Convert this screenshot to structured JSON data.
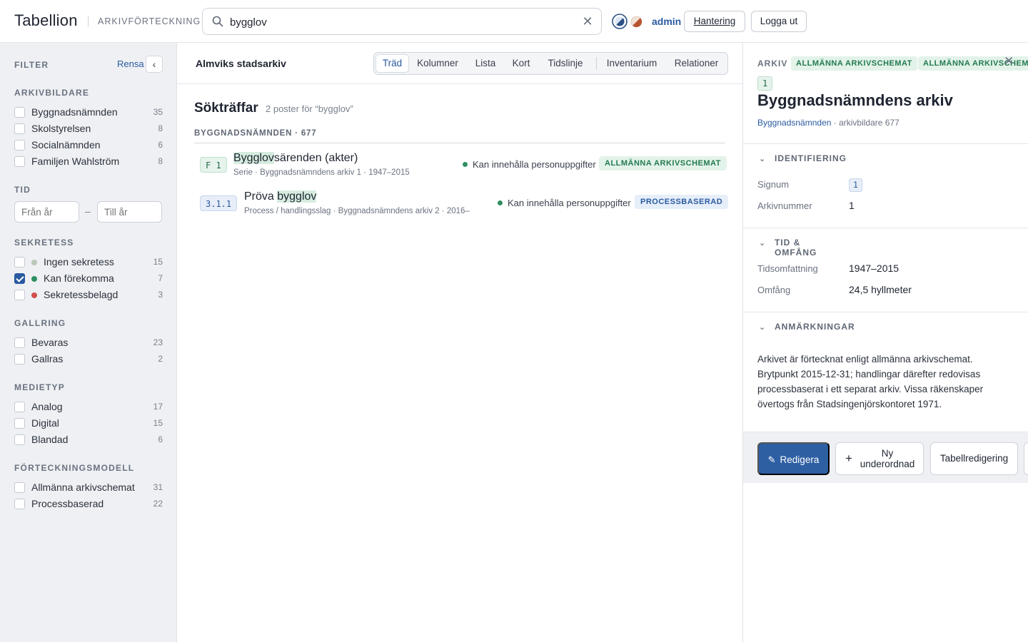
{
  "header": {
    "brand": "Tabellion",
    "subtitle": "ARKIVFÖRTECKNING",
    "search_value": "bygglov",
    "user": "admin",
    "manage_label": "Hantering",
    "logout_label": "Logga ut"
  },
  "sidebar": {
    "title": "FILTER",
    "clear": "Rensa",
    "groups": {
      "creators": {
        "title": "ARKIVBILDARE",
        "items": [
          {
            "label": "Byggnadsnämnden",
            "count": "35",
            "checked": false
          },
          {
            "label": "Skolstyrelsen",
            "count": "8",
            "checked": false
          },
          {
            "label": "Socialnämnden",
            "count": "6",
            "checked": false
          },
          {
            "label": "Familjen Wahlström",
            "count": "8",
            "checked": false
          }
        ]
      },
      "time": {
        "title": "TID",
        "from_placeholder": "Från år",
        "to_placeholder": "Till år",
        "separator": "–"
      },
      "secrecy": {
        "title": "SEKRETESS",
        "items": [
          {
            "label": "Ingen sekretess",
            "count": "15",
            "checked": false,
            "color": "#b9c7b7"
          },
          {
            "label": "Kan förekomma",
            "count": "7",
            "checked": true,
            "color": "#2f8f62"
          },
          {
            "label": "Sekretessbelagd",
            "count": "3",
            "checked": false,
            "color": "#d0504a"
          }
        ]
      },
      "disposal": {
        "title": "GALLRING",
        "items": [
          {
            "label": "Bevaras",
            "count": "23",
            "checked": false
          },
          {
            "label": "Gallras",
            "count": "2",
            "checked": false
          }
        ]
      },
      "media": {
        "title": "MEDIETYP",
        "items": [
          {
            "label": "Analog",
            "count": "17",
            "checked": false
          },
          {
            "label": "Digital",
            "count": "15",
            "checked": false
          },
          {
            "label": "Blandad",
            "count": "6",
            "checked": false
          }
        ]
      },
      "model": {
        "title": "FÖRTECKNINGSMODELL",
        "items": [
          {
            "label": "Allmänna arkivschemat",
            "count": "31",
            "checked": false
          },
          {
            "label": "Processbaserad",
            "count": "22",
            "checked": false
          }
        ]
      }
    }
  },
  "main": {
    "archive_name": "Almviks stadsarkiv",
    "tabs": [
      "Träd",
      "Kolumner",
      "Lista",
      "Kort",
      "Tidslinje",
      "Inventarium",
      "Relationer"
    ],
    "active_tab": "Träd",
    "results_title": "Sökträffar",
    "results_count": "2 poster för “bygglov”",
    "group_heading": "BYGGNADSNÄMNDEN · 677",
    "hits": [
      {
        "signum": "F 1",
        "title_highlight": "Bygglov",
        "title_rest": "särenden (akter)",
        "meta": "Serie · Byggnadsnämndens arkiv 1 · 1947–2015",
        "pii": "Kan innehålla personuppgifter",
        "badge": "ALLMÄNNA ARKIVSCHEMAT"
      },
      {
        "signum": "3.1.1",
        "title_prefix": "Pröva ",
        "title_highlight": "bygglov",
        "meta": "Process / handlingsslag · Byggnadsnämndens arkiv 2 · 2016–",
        "pii": "Kan innehålla personuppgifter",
        "badge": "PROCESSBASERAD"
      }
    ]
  },
  "detail": {
    "kind": "ARKIV",
    "badges": [
      "ALLMÄNNA ARKIVSCHEMAT",
      "ALLMÄNNA ARKIVSCHEMAT"
    ],
    "signum": "1",
    "title": "Byggnadsnämndens arkiv",
    "creator_link": "Byggnadsnämnden",
    "creator_rest": " · arkivbildare 677",
    "sections": {
      "identification": {
        "title": "IDENTIFIERING",
        "signum_label": "Signum",
        "signum_value": "1",
        "number_label": "Arkivnummer",
        "number_value": "1"
      },
      "time_extent": {
        "title": "TID & OMFÅNG",
        "span_label": "Tidsomfattning",
        "span_value": "1947–2015",
        "extent_label": "Omfång",
        "extent_value": "24,5 hyllmeter"
      },
      "notes": {
        "title": "ANMÄRKNINGAR",
        "text": "Arkivet är förtecknat enligt allmänna arkivschemat. Brytpunkt 2015-12-31; handlingar därefter redovisas processbaserat i ett separat arkiv. Vissa räkenskaper övertogs från Stadsingenjörskontoret 1971."
      }
    },
    "actions": {
      "edit": "Redigera",
      "new_child_line1": "Ny",
      "new_child_line2": "underordnad",
      "table_edit": "Tabellredigering"
    }
  }
}
